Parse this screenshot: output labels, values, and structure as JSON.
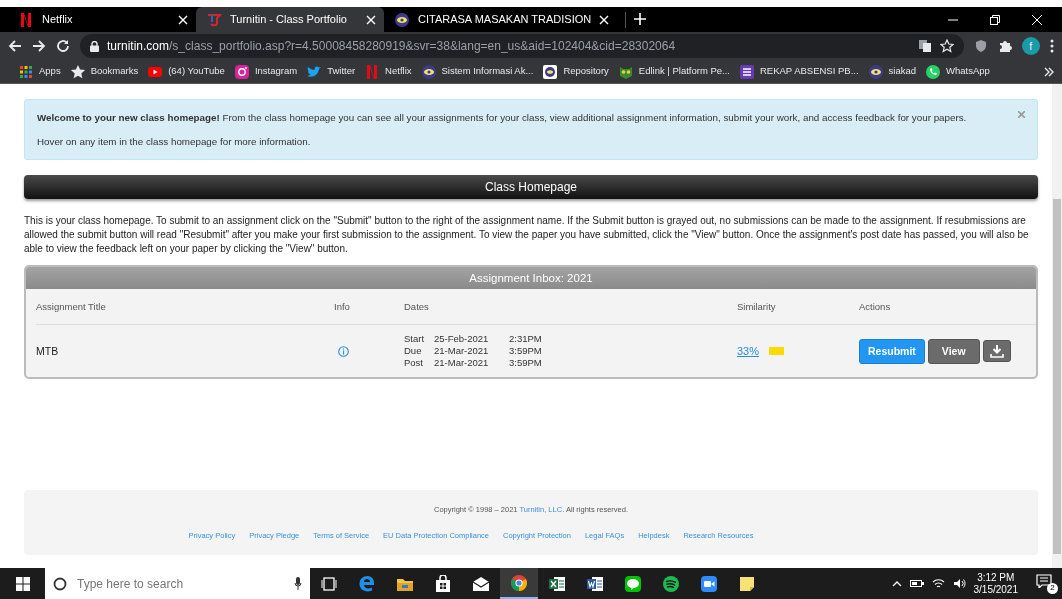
{
  "browser": {
    "tabs": [
      {
        "title": "Netflix",
        "kind": "netflix",
        "selected": false
      },
      {
        "title": "Turnitin - Class Portfolio",
        "kind": "turnitin",
        "selected": true
      },
      {
        "title": "CITARASA MASAKAN TRADISION",
        "kind": "eye-logo",
        "selected": false
      }
    ],
    "address": {
      "domain": "turnitin.com",
      "path": "/s_class_portfolio.asp?r=4.50008458280919&svr=38&lang=en_us&aid=102404&cid=28302064"
    },
    "profile_initial": "f",
    "bookmarks": [
      {
        "label": "Apps",
        "kind": "apps"
      },
      {
        "label": "Bookmarks",
        "kind": "star"
      },
      {
        "label": "(64) YouTube",
        "kind": "youtube"
      },
      {
        "label": "Instagram",
        "kind": "instagram"
      },
      {
        "label": "Twitter",
        "kind": "twitter"
      },
      {
        "label": "Netflix",
        "kind": "netflix"
      },
      {
        "label": "Sistem Informasi Ak...",
        "kind": "eye-logo"
      },
      {
        "label": "Repository",
        "kind": "repository"
      },
      {
        "label": "Edlink | Platform Pe...",
        "kind": "edlink"
      },
      {
        "label": "REKAP ABSENSI PB...",
        "kind": "form"
      },
      {
        "label": "siakad",
        "kind": "eye-logo"
      },
      {
        "label": "WhatsApp",
        "kind": "whatsapp"
      }
    ]
  },
  "alert": {
    "text": "**Welcome to your new class homepage!** From the class homepage you can see all your assignments for your class, view additional assignment information, submit your work, and access feedback for your papers.",
    "hint": "Hover on any item in the class homepage for more information."
  },
  "header": {
    "title": "Class Homepage"
  },
  "description": "This is your class homepage. To submit to an assignment click on the \"Submit\" button to the right of the assignment name. If the Submit button is grayed out, no submissions can be made to the assignment. If resubmissions are allowed the submit button will read \"Resubmit\" after you make your first submission to the assignment. To view the paper you have submitted, click the \"View\" button. Once the assignment's post date has passed, you will also be able to view the feedback left on your paper by clicking the \"View\" button.",
  "inbox": {
    "title": "Assignment Inbox: 2021",
    "columns": [
      "Assignment Title",
      "Info",
      "Dates",
      "Similarity",
      "Actions"
    ],
    "rows": [
      {
        "title": "MTB",
        "dates": [
          {
            "label": "Start",
            "date": "25-Feb-2021",
            "time": "2:31PM"
          },
          {
            "label": "Due",
            "date": "21-Mar-2021",
            "time": "3:59PM"
          },
          {
            "label": "Post",
            "date": "21-Mar-2021",
            "time": "3:59PM"
          }
        ],
        "similarity": "33%",
        "color": "#ffd800",
        "actions": [
          "Resubmit",
          "View"
        ]
      }
    ]
  },
  "footer": {
    "copyright": "Copyright © 1998 – 2021 ",
    "company": "Turnitin, LLC",
    "rights": ". All rights reserved.",
    "links": [
      "Privacy Policy",
      "Privacy Pledge",
      "Terms of Service",
      "EU Data Protection Compliance",
      "Copyright Protection",
      "Legal FAQs",
      "Helpdesk",
      "Research Resources"
    ]
  },
  "taskbar": {
    "search_placeholder": "Type here to search",
    "apps": [
      {
        "kind": "taskview",
        "active": false
      },
      {
        "kind": "edge",
        "active": false
      },
      {
        "kind": "explorer",
        "active": false
      },
      {
        "kind": "store",
        "active": false
      },
      {
        "kind": "mail",
        "active": false
      },
      {
        "kind": "chrome",
        "active": true
      },
      {
        "kind": "excel",
        "active": false
      },
      {
        "kind": "word",
        "active": false
      },
      {
        "kind": "line",
        "active": false
      },
      {
        "kind": "spotify",
        "active": false
      },
      {
        "kind": "zoom",
        "active": false
      },
      {
        "kind": "sticky",
        "active": false
      }
    ],
    "time": "3:12 PM",
    "date": "3/15/2021",
    "notifications": "2"
  }
}
